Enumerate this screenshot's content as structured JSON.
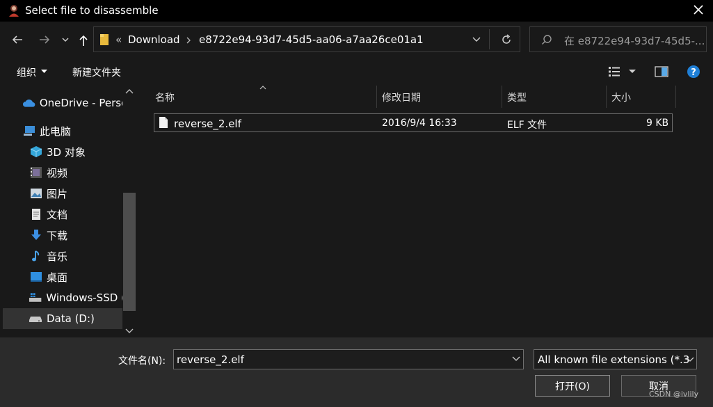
{
  "window": {
    "title": "Select file to disassemble"
  },
  "nav": {
    "breadcrumb_overflow": "«",
    "breadcrumbs": [
      "Download",
      "e8722e94-93d7-45d5-aa06-a7aa26ce01a1"
    ],
    "search_placeholder": "在 e8722e94-93d7-45d5-..."
  },
  "toolbar": {
    "organize_label": "组织",
    "new_folder_label": "新建文件夹"
  },
  "sidebar": {
    "items": [
      {
        "label": "OneDrive - Perso",
        "icon": "cloud-icon"
      },
      {
        "label": "此电脑",
        "icon": "computer-icon"
      },
      {
        "label": "3D 对象",
        "icon": "cube-icon"
      },
      {
        "label": "视频",
        "icon": "video-icon"
      },
      {
        "label": "图片",
        "icon": "picture-icon"
      },
      {
        "label": "文档",
        "icon": "document-icon"
      },
      {
        "label": "下载",
        "icon": "download-icon"
      },
      {
        "label": "音乐",
        "icon": "music-icon"
      },
      {
        "label": "桌面",
        "icon": "desktop-icon"
      },
      {
        "label": "Windows-SSD (",
        "icon": "drive-icon"
      },
      {
        "label": "Data (D:)",
        "icon": "drive-icon"
      }
    ]
  },
  "filelist": {
    "columns": [
      "名称",
      "修改日期",
      "类型",
      "大小"
    ],
    "rows": [
      {
        "name": "reverse_2.elf",
        "modified": "2016/9/4 16:33",
        "type": "ELF 文件",
        "size": "9 KB"
      }
    ]
  },
  "footer": {
    "filename_label": "文件名(N):",
    "filename_value": "reverse_2.elf",
    "filter_value": "All known file extensions (*.3",
    "open_label": "打开(O)",
    "cancel_label": "取消"
  },
  "watermark": "CSDN @ivlily"
}
